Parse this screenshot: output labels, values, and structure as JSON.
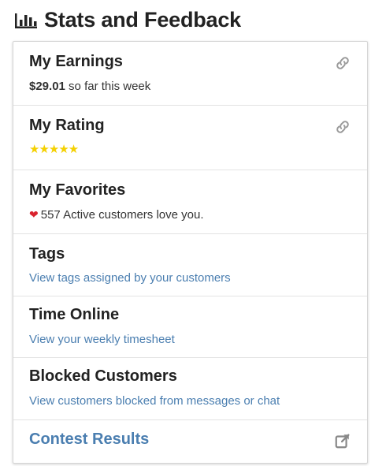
{
  "header": {
    "title": "Stats and Feedback",
    "icon": "bar-chart-icon"
  },
  "rows": {
    "earnings": {
      "title": "My Earnings",
      "amount": "$29.01",
      "suffix": " so far this week",
      "icon": "link-icon"
    },
    "rating": {
      "title": "My Rating",
      "stars": "★★★★★",
      "star_count": 5,
      "icon": "link-icon"
    },
    "favorites": {
      "title": "My Favorites",
      "text": "557 Active customers love you.",
      "icon": "heart-icon"
    },
    "tags": {
      "title": "Tags",
      "link": "View tags assigned by your customers"
    },
    "time_online": {
      "title": "Time Online",
      "link": "View your weekly timesheet"
    },
    "blocked": {
      "title": "Blocked Customers",
      "link": "View customers blocked from messages or chat"
    },
    "contest": {
      "title": "Contest Results",
      "icon": "external-link-icon"
    }
  },
  "colors": {
    "link": "#4a7eb0",
    "star": "#f4d000",
    "heart": "#d9232e",
    "border": "#d6d6d6"
  }
}
